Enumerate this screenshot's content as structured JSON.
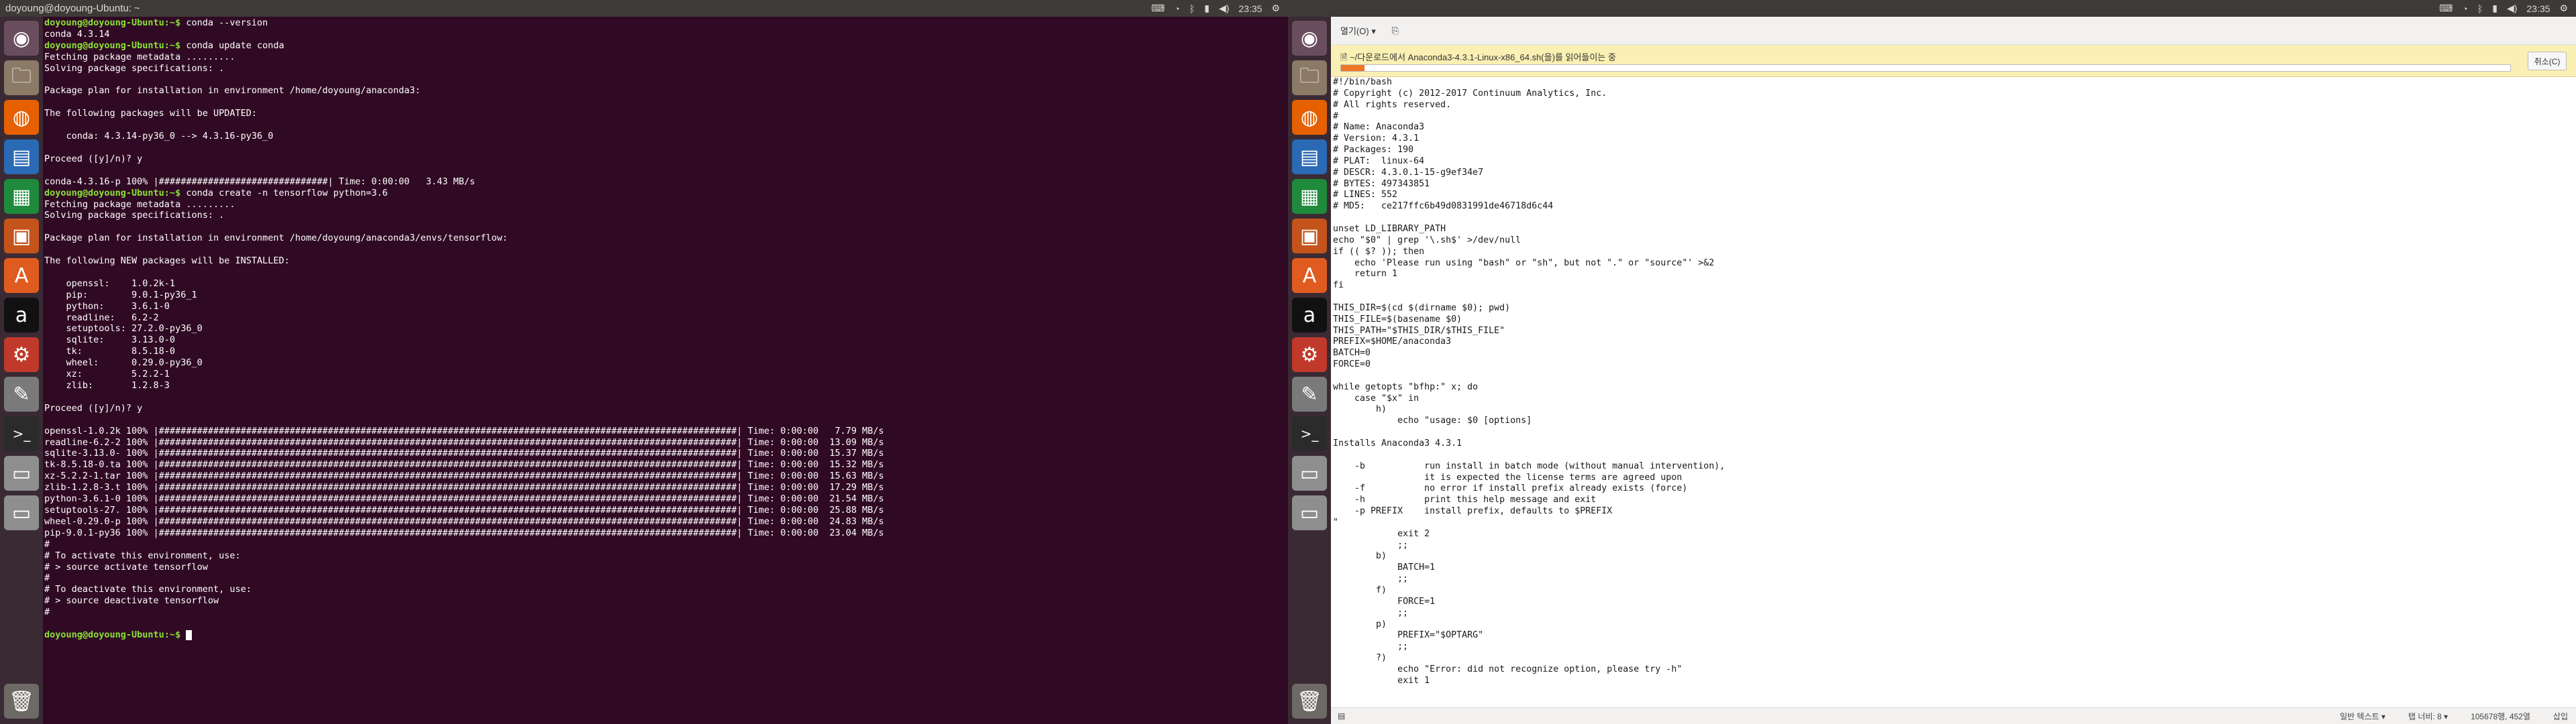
{
  "left_window_title": "doyoung@doyoung-Ubuntu: ~",
  "clock": "23:35",
  "terminal": {
    "lines": [
      {
        "prompt": "doyoung@doyoung-Ubuntu:~$ ",
        "text": "conda --version"
      },
      {
        "text": "conda 4.3.14"
      },
      {
        "prompt": "doyoung@doyoung-Ubuntu:~$ ",
        "text": "conda update conda"
      },
      {
        "text": "Fetching package metadata ........."
      },
      {
        "text": "Solving package specifications: ."
      },
      {
        "text": ""
      },
      {
        "text": "Package plan for installation in environment /home/doyoung/anaconda3:"
      },
      {
        "text": ""
      },
      {
        "text": "The following packages will be UPDATED:"
      },
      {
        "text": ""
      },
      {
        "text": "    conda: 4.3.14-py36_0 --> 4.3.16-py36_0"
      },
      {
        "text": ""
      },
      {
        "text": "Proceed ([y]/n)? y"
      },
      {
        "text": ""
      },
      {
        "text": "conda-4.3.16-p 100% |###############################| Time: 0:00:00   3.43 MB/s"
      },
      {
        "prompt": "doyoung@doyoung-Ubuntu:~$ ",
        "text": "conda create -n tensorflow python=3.6"
      },
      {
        "text": "Fetching package metadata ........."
      },
      {
        "text": "Solving package specifications: ."
      },
      {
        "text": ""
      },
      {
        "text": "Package plan for installation in environment /home/doyoung/anaconda3/envs/tensorflow:"
      },
      {
        "text": ""
      },
      {
        "text": "The following NEW packages will be INSTALLED:"
      },
      {
        "text": ""
      },
      {
        "text": "    openssl:    1.0.2k-1"
      },
      {
        "text": "    pip:        9.0.1-py36_1"
      },
      {
        "text": "    python:     3.6.1-0"
      },
      {
        "text": "    readline:   6.2-2"
      },
      {
        "text": "    setuptools: 27.2.0-py36_0"
      },
      {
        "text": "    sqlite:     3.13.0-0"
      },
      {
        "text": "    tk:         8.5.18-0"
      },
      {
        "text": "    wheel:      0.29.0-py36_0"
      },
      {
        "text": "    xz:         5.2.2-1"
      },
      {
        "text": "    zlib:       1.2.8-3"
      },
      {
        "text": ""
      },
      {
        "text": "Proceed ([y]/n)? y"
      },
      {
        "text": ""
      },
      {
        "text": "openssl-1.0.2k 100% |##########################################################################################################| Time: 0:00:00   7.79 MB/s"
      },
      {
        "text": "readline-6.2-2 100% |##########################################################################################################| Time: 0:00:00  13.09 MB/s"
      },
      {
        "text": "sqlite-3.13.0- 100% |##########################################################################################################| Time: 0:00:00  15.37 MB/s"
      },
      {
        "text": "tk-8.5.18-0.ta 100% |##########################################################################################################| Time: 0:00:00  15.32 MB/s"
      },
      {
        "text": "xz-5.2.2-1.tar 100% |##########################################################################################################| Time: 0:00:00  15.63 MB/s"
      },
      {
        "text": "zlib-1.2.8-3.t 100% |##########################################################################################################| Time: 0:00:00  17.29 MB/s"
      },
      {
        "text": "python-3.6.1-0 100% |##########################################################################################################| Time: 0:00:00  21.54 MB/s"
      },
      {
        "text": "setuptools-27. 100% |##########################################################################################################| Time: 0:00:00  25.88 MB/s"
      },
      {
        "text": "wheel-0.29.0-p 100% |##########################################################################################################| Time: 0:00:00  24.83 MB/s"
      },
      {
        "text": "pip-9.0.1-py36 100% |##########################################################################################################| Time: 0:00:00  23.04 MB/s"
      },
      {
        "text": "#"
      },
      {
        "text": "# To activate this environment, use:"
      },
      {
        "text": "# > source activate tensorflow"
      },
      {
        "text": "#"
      },
      {
        "text": "# To deactivate this environment, use:"
      },
      {
        "text": "# > source deactivate tensorflow"
      },
      {
        "text": "#"
      },
      {
        "text": ""
      },
      {
        "prompt": "doyoung@doyoung-Ubuntu:~$ ",
        "text": "",
        "cursor": true
      }
    ]
  },
  "viewer": {
    "menu_open": "열기(O)",
    "download_label": "~/다운로드에서 Anaconda3-4.3.1-Linux-x86_64.sh(을)를 읽어들이는 중",
    "download_progress": 0.02,
    "cancel_label": "취소(C)",
    "status_syntax": "일반 텍스트",
    "status_tab": "탭 너비: 8",
    "status_position": "105678행, 452열",
    "status_mode": "삽입",
    "script_lines": [
      "#!/bin/bash",
      "# Copyright (c) 2012-2017 Continuum Analytics, Inc.",
      "# All rights reserved.",
      "#",
      "# Name: Anaconda3",
      "# Version: 4.3.1",
      "# Packages: 190",
      "# PLAT:  linux-64",
      "# DESCR: 4.3.0.1-15-g9ef34e7",
      "# BYTES: 497343851",
      "# LINES: 552",
      "# MD5:   ce217ffc6b49d0831991de46718d6c44",
      "",
      "unset LD_LIBRARY_PATH",
      "echo \"$0\" | grep '\\.sh$' >/dev/null",
      "if (( $? )); then",
      "    echo 'Please run using \"bash\" or \"sh\", but not \".\" or \"source\"' >&2",
      "    return 1",
      "fi",
      "",
      "THIS_DIR=$(cd $(dirname $0); pwd)",
      "THIS_FILE=$(basename $0)",
      "THIS_PATH=\"$THIS_DIR/$THIS_FILE\"",
      "PREFIX=$HOME/anaconda3",
      "BATCH=0",
      "FORCE=0",
      "",
      "while getopts \"bfhp:\" x; do",
      "    case \"$x\" in",
      "        h)",
      "            echo \"usage: $0 [options]",
      "",
      "Installs Anaconda3 4.3.1",
      "",
      "    -b           run install in batch mode (without manual intervention),",
      "                 it is expected the license terms are agreed upon",
      "    -f           no error if install prefix already exists (force)",
      "    -h           print this help message and exit",
      "    -p PREFIX    install prefix, defaults to $PREFIX",
      "\"",
      "            exit 2",
      "            ;;",
      "        b)",
      "            BATCH=1",
      "            ;;",
      "        f)",
      "            FORCE=1",
      "            ;;",
      "        p)",
      "            PREFIX=\"$OPTARG\"",
      "            ;;",
      "        ?)",
      "            echo \"Error: did not recognize option, please try -h\"",
      "            exit 1"
    ]
  },
  "launcher_icons": [
    {
      "name": "ubuntu-dash-icon",
      "glyph": "◉",
      "color": "#6a4e5e"
    },
    {
      "name": "files-icon",
      "glyph": "🗀",
      "color": "#8b7a66"
    },
    {
      "name": "firefox-icon",
      "glyph": "◍",
      "color": "#e66000"
    },
    {
      "name": "writer-icon",
      "glyph": "▤",
      "color": "#2a6ab4"
    },
    {
      "name": "calc-icon",
      "glyph": "▦",
      "color": "#1f8a3b"
    },
    {
      "name": "impress-icon",
      "glyph": "▣",
      "color": "#c4541b"
    },
    {
      "name": "software-center-icon",
      "glyph": "A",
      "color": "#e05b20"
    },
    {
      "name": "amazon-icon",
      "glyph": "a",
      "color": "#111111"
    },
    {
      "name": "settings-icon",
      "glyph": "⚙",
      "color": "#c0392b"
    },
    {
      "name": "text-editor-icon",
      "glyph": "✎",
      "color": "#7a7a7a"
    },
    {
      "name": "terminal-icon",
      "glyph": ">_",
      "color": "#2b2b2b"
    },
    {
      "name": "drive-icon",
      "glyph": "▭",
      "color": "#8e8e8e"
    },
    {
      "name": "drive2-icon",
      "glyph": "▭",
      "color": "#8e8e8e"
    }
  ]
}
